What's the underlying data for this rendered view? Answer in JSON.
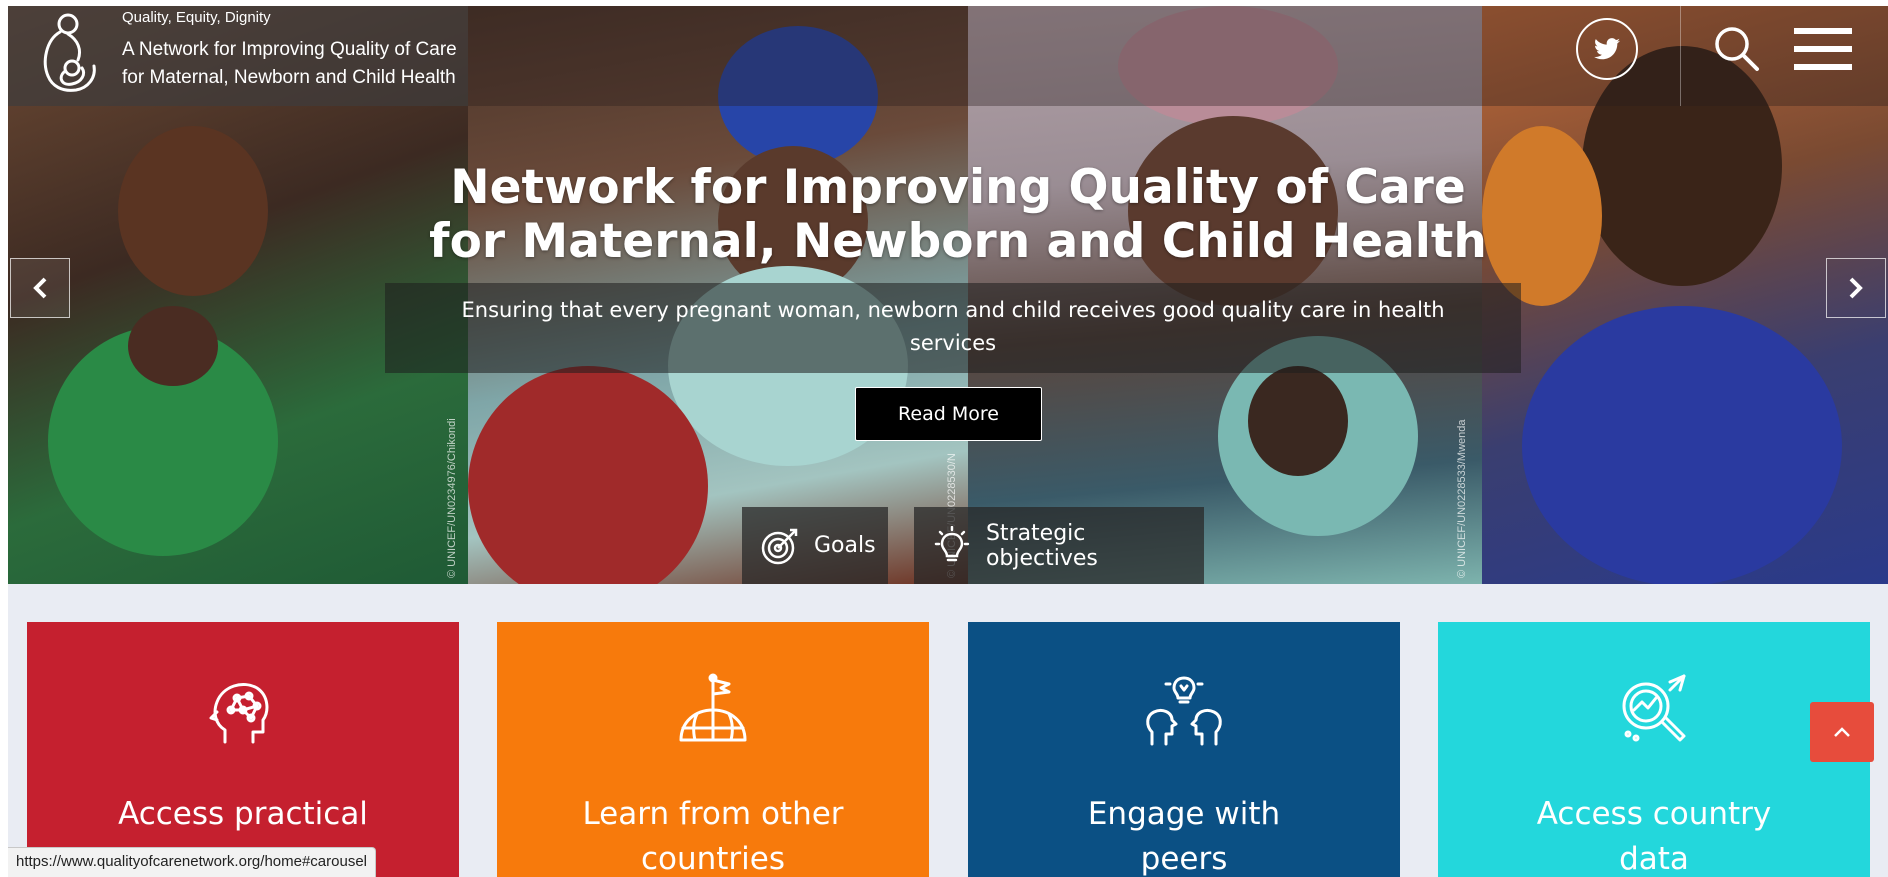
{
  "header": {
    "tagline": "Quality, Equity, Dignity",
    "org_name": "A Network for Improving Quality of Care for Maternal, Newborn and Child Health",
    "icons": [
      "logo-mother-child-icon",
      "twitter-icon",
      "search-icon",
      "hamburger-menu-icon"
    ]
  },
  "hero": {
    "title": "Network for Improving Quality of Care for Maternal, Newborn and Child Health",
    "subtitle": "Ensuring that every pregnant woman, newborn and child receives good quality care in health services",
    "read_more_label": "Read More",
    "photo_credits": [
      "© UNICEF/UN0234976/Chikondi",
      "© UNICEF/UN0228530/N",
      "© UNICEF/UN0228533/Mwenda"
    ],
    "pills": {
      "goals_label": "Goals",
      "objectives_label": "Strategic objectives"
    },
    "prev_icon": "chevron-left-icon",
    "next_icon": "chevron-right-icon"
  },
  "cards": [
    {
      "label": "Access practical",
      "label2": "",
      "color": "#c5202f",
      "icon": "brain-icon"
    },
    {
      "label": "Learn from other",
      "label2": "countries",
      "color": "#f77a0c",
      "icon": "globe-flag-icon"
    },
    {
      "label": "Engage with",
      "label2": "peers",
      "color": "#0b5084",
      "icon": "peers-idea-icon"
    },
    {
      "label": "Access country",
      "label2": "data",
      "color": "#23d7dc",
      "icon": "data-magnifier-icon"
    }
  ],
  "back_to_top_icon": "chevron-up-icon",
  "status_url": "https://www.qualityofcarenetwork.org/home#carousel"
}
